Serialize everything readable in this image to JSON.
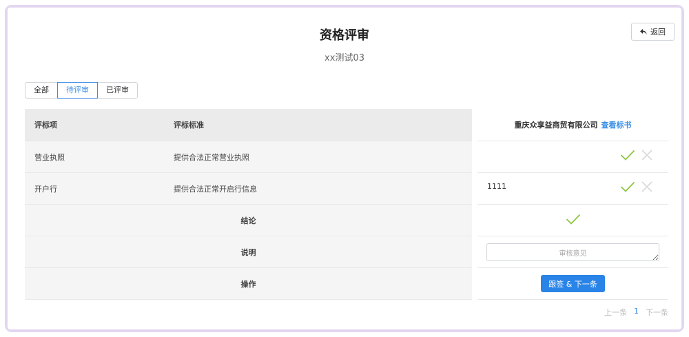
{
  "header": {
    "title": "资格评审",
    "subtitle": "xx测试03",
    "back_label": "返回"
  },
  "tabs": [
    {
      "label": "全部",
      "active": false
    },
    {
      "label": "待评审",
      "active": true
    },
    {
      "label": "已评审",
      "active": false
    }
  ],
  "table": {
    "col_item": "评标项",
    "col_standard": "评标标准",
    "rows": [
      {
        "item": "营业执照",
        "standard": "提供合法正常营业执照"
      },
      {
        "item": "开户行",
        "standard": "提供合法正常开启行信息"
      }
    ],
    "conclusion_label": "结论",
    "remark_label": "说明",
    "action_label": "操作"
  },
  "bidder": {
    "name": "重庆众享益商贸有限公司",
    "link_label": "查看标书",
    "row_values": [
      "",
      "1111"
    ],
    "remark_placeholder": "审核意见",
    "submit_label": "跟签 & 下一条"
  },
  "pagination": {
    "prev_label": "上一条",
    "current": "1",
    "next_label": "下一条"
  },
  "colors": {
    "accent": "#2a84e8",
    "check": "#8cc63f",
    "cross": "#d9d9d9"
  }
}
